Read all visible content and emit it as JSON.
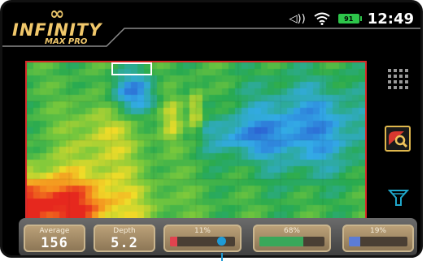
{
  "header": {
    "brand": "INFINITY",
    "model": "MAX PRO",
    "symbol": "∞",
    "volume_icon": "speaker-volume-icon",
    "wifi_icon": "wifi-icon",
    "battery_level": "91",
    "time": "12:49"
  },
  "sidebar": {
    "grid_icon": "grid-view-icon",
    "search_icon": "target-search-icon",
    "filter_icon": "filter-icon"
  },
  "stats": {
    "average_label": "Average",
    "average_value": "156",
    "depth_label": "Depth",
    "depth_value": "5.2",
    "red_pct_label": "11%",
    "red_fraction": 0.11,
    "green_pct_label": "68%",
    "green_fraction": 0.68,
    "blue_pct_label": "19%",
    "blue_fraction": 0.19
  },
  "colors": {
    "accent_gold": "#e9c46a",
    "frame_red": "#d92b2b",
    "red_bar": "#e0434f",
    "green_bar": "#39a85a",
    "blue_bar": "#5c7cd6",
    "pointer": "#1f9bd6"
  }
}
